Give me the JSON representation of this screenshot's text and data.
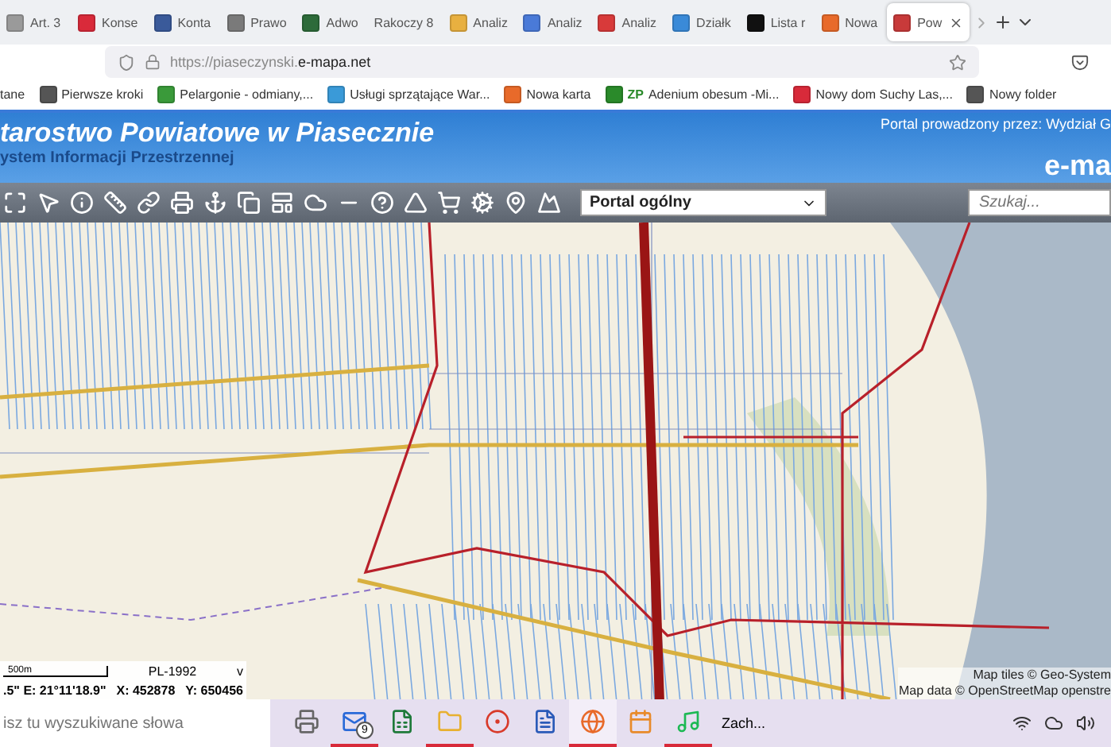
{
  "browser_tabs": [
    {
      "label": "Art. 3",
      "color": "#9a9a9a",
      "selected": false
    },
    {
      "label": "Konse",
      "color": "#d92a3a",
      "selected": false
    },
    {
      "label": "Konta",
      "color": "#3a5a9a",
      "selected": false
    },
    {
      "label": "Prawo",
      "color": "#7a7a7a",
      "selected": false
    },
    {
      "label": "Adwo",
      "color": "#2d6b3a",
      "selected": false
    },
    {
      "label": "Rakoczy 8",
      "selected": false
    },
    {
      "label": "Analiz",
      "color": "#e8b040",
      "selected": false
    },
    {
      "label": "Analiz",
      "color": "#4a7ad8",
      "selected": false
    },
    {
      "label": "Analiz",
      "color": "#d83a3a",
      "selected": false
    },
    {
      "label": "Działk",
      "color": "#3a8ad8",
      "selected": false
    },
    {
      "label": "Lista r",
      "color": "#111111",
      "selected": false
    },
    {
      "label": "Nowa",
      "color": "#e86a2a",
      "selected": false
    },
    {
      "label": "Pow",
      "color": "#c83a3a",
      "selected": true
    }
  ],
  "address_bar": {
    "url_host_prefix": "https://piaseczynski.",
    "url_domain": "e-mapa.net"
  },
  "bookmarks": [
    {
      "label": "tane"
    },
    {
      "label": "Pierwsze kroki",
      "color": "#555555"
    },
    {
      "label": "Pelargonie - odmiany,...",
      "color": "#3a9a3a"
    },
    {
      "label": "Usługi sprzątające War...",
      "color": "#3a9ad8"
    },
    {
      "label": "Nowa karta",
      "color": "#e86a2a"
    },
    {
      "label": "Adenium obesum -Mi...",
      "color": "#2a8a2a",
      "badge": "ZP"
    },
    {
      "label": "Nowy dom Suchy Las,...",
      "color": "#d82a3a"
    },
    {
      "label": "Nowy folder",
      "color": "#555555"
    }
  ],
  "header": {
    "title": "tarostwo Powiatowe w Piasecznie",
    "subtitle": "ystem Informacji Przestrzennej",
    "operator": "Portal prowadzony przez: Wydział G",
    "brand": "e-ma"
  },
  "toolbar": {
    "portal_select": "Portal ogólny",
    "search": {
      "placeholder": "Szukaj..."
    }
  },
  "map": {
    "kind": "picture",
    "scale": "500m",
    "crs": "PL-1992",
    "crs_caret": "v",
    "coords": [
      ".5\" E: 21°11'18.9\"",
      "X: 452878",
      "Y: 650456"
    ],
    "attribution": [
      "Map tiles © Geo-System",
      "Map data © OpenStreetMap openstre"
    ]
  },
  "taskbar": {
    "search": {
      "placeholder": "isz tu wyszukiwane słowa"
    },
    "apps": [
      {
        "kind": "printer",
        "running": false,
        "selected": false
      },
      {
        "kind": "mail",
        "badge": "9",
        "running": true,
        "selected": false
      },
      {
        "kind": "sheet",
        "running": false,
        "selected": false
      },
      {
        "kind": "folder",
        "running": true,
        "selected": false
      },
      {
        "kind": "chrome",
        "running": false,
        "selected": false
      },
      {
        "kind": "word",
        "running": false,
        "selected": false
      },
      {
        "kind": "firefox",
        "running": true,
        "selected": true
      },
      {
        "kind": "calendar",
        "running": false,
        "selected": false
      },
      {
        "kind": "music",
        "running": true,
        "selected": false
      }
    ],
    "weather": "Zach..."
  }
}
